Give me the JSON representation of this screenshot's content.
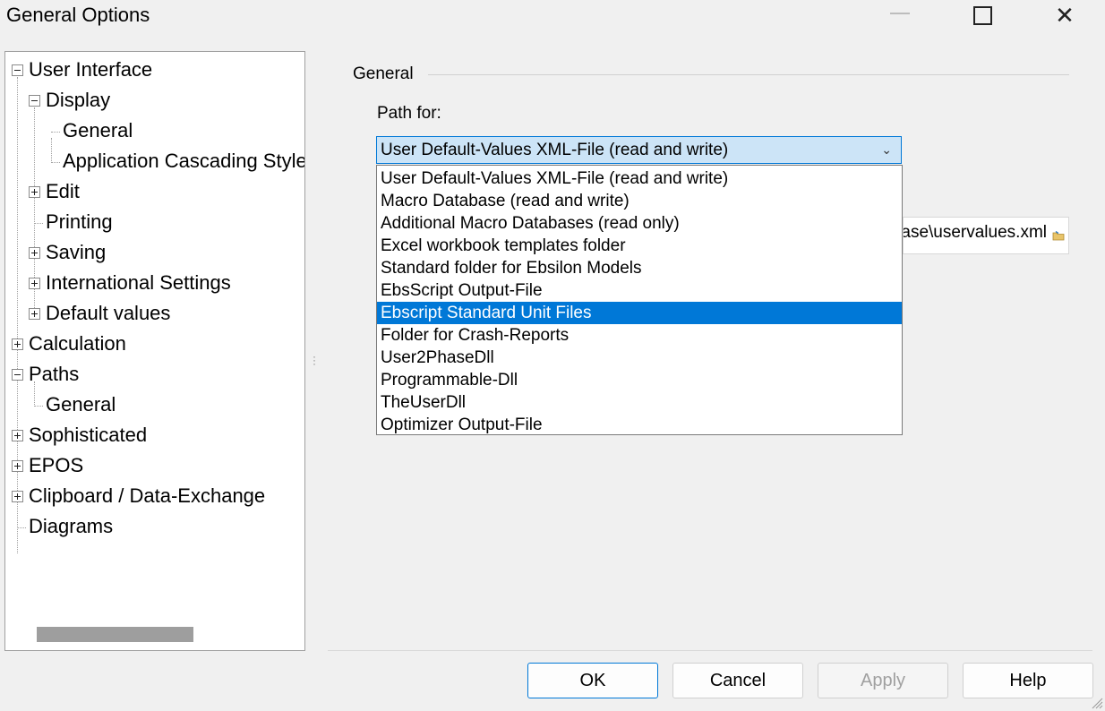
{
  "window": {
    "title": "General Options"
  },
  "titlebar": {
    "close_glyph": "✕"
  },
  "tree": {
    "items": [
      {
        "label": "User Interface",
        "toggle": "minus"
      },
      {
        "label": "Display",
        "toggle": "minus"
      },
      {
        "label": "General",
        "toggle": "none"
      },
      {
        "label": "Application Cascading Style Sheets",
        "toggle": "none"
      },
      {
        "label": "Edit",
        "toggle": "plus"
      },
      {
        "label": "Printing",
        "toggle": "none"
      },
      {
        "label": "Saving",
        "toggle": "plus"
      },
      {
        "label": "International Settings",
        "toggle": "plus"
      },
      {
        "label": "Default values",
        "toggle": "plus"
      },
      {
        "label": "Calculation",
        "toggle": "plus"
      },
      {
        "label": "Paths",
        "toggle": "minus",
        "selected": true
      },
      {
        "label": "General",
        "toggle": "none"
      },
      {
        "label": "Sophisticated",
        "toggle": "plus"
      },
      {
        "label": "EPOS",
        "toggle": "plus"
      },
      {
        "label": "Clipboard / Data-Exchange",
        "toggle": "plus"
      },
      {
        "label": "Diagrams",
        "toggle": "none"
      }
    ]
  },
  "panel": {
    "group_title": "General",
    "path_label": "Path for:",
    "combo_value": "User Default-Values XML-File (read and write)",
    "path_value": "C:\\Ebsilon\\Database\\uservalues.xml"
  },
  "dropdown": {
    "options": [
      "User Default-Values XML-File (read and write)",
      "Macro Database (read and write)",
      "Additional Macro Databases (read only)",
      "Excel workbook templates folder",
      "Standard folder for Ebsilon Models",
      "EbsScript Output-File",
      "Ebscript Standard Unit Files",
      "Folder for Crash-Reports",
      "User2PhaseDll",
      "Programmable-Dll",
      "TheUserDll",
      "Optimizer Output-File"
    ],
    "selected_index": 6
  },
  "buttons": {
    "ok": "OK",
    "cancel": "Cancel",
    "apply": "Apply",
    "help": "Help"
  },
  "colors": {
    "accent": "#0078d7",
    "combo_bg": "#cce4f7"
  }
}
